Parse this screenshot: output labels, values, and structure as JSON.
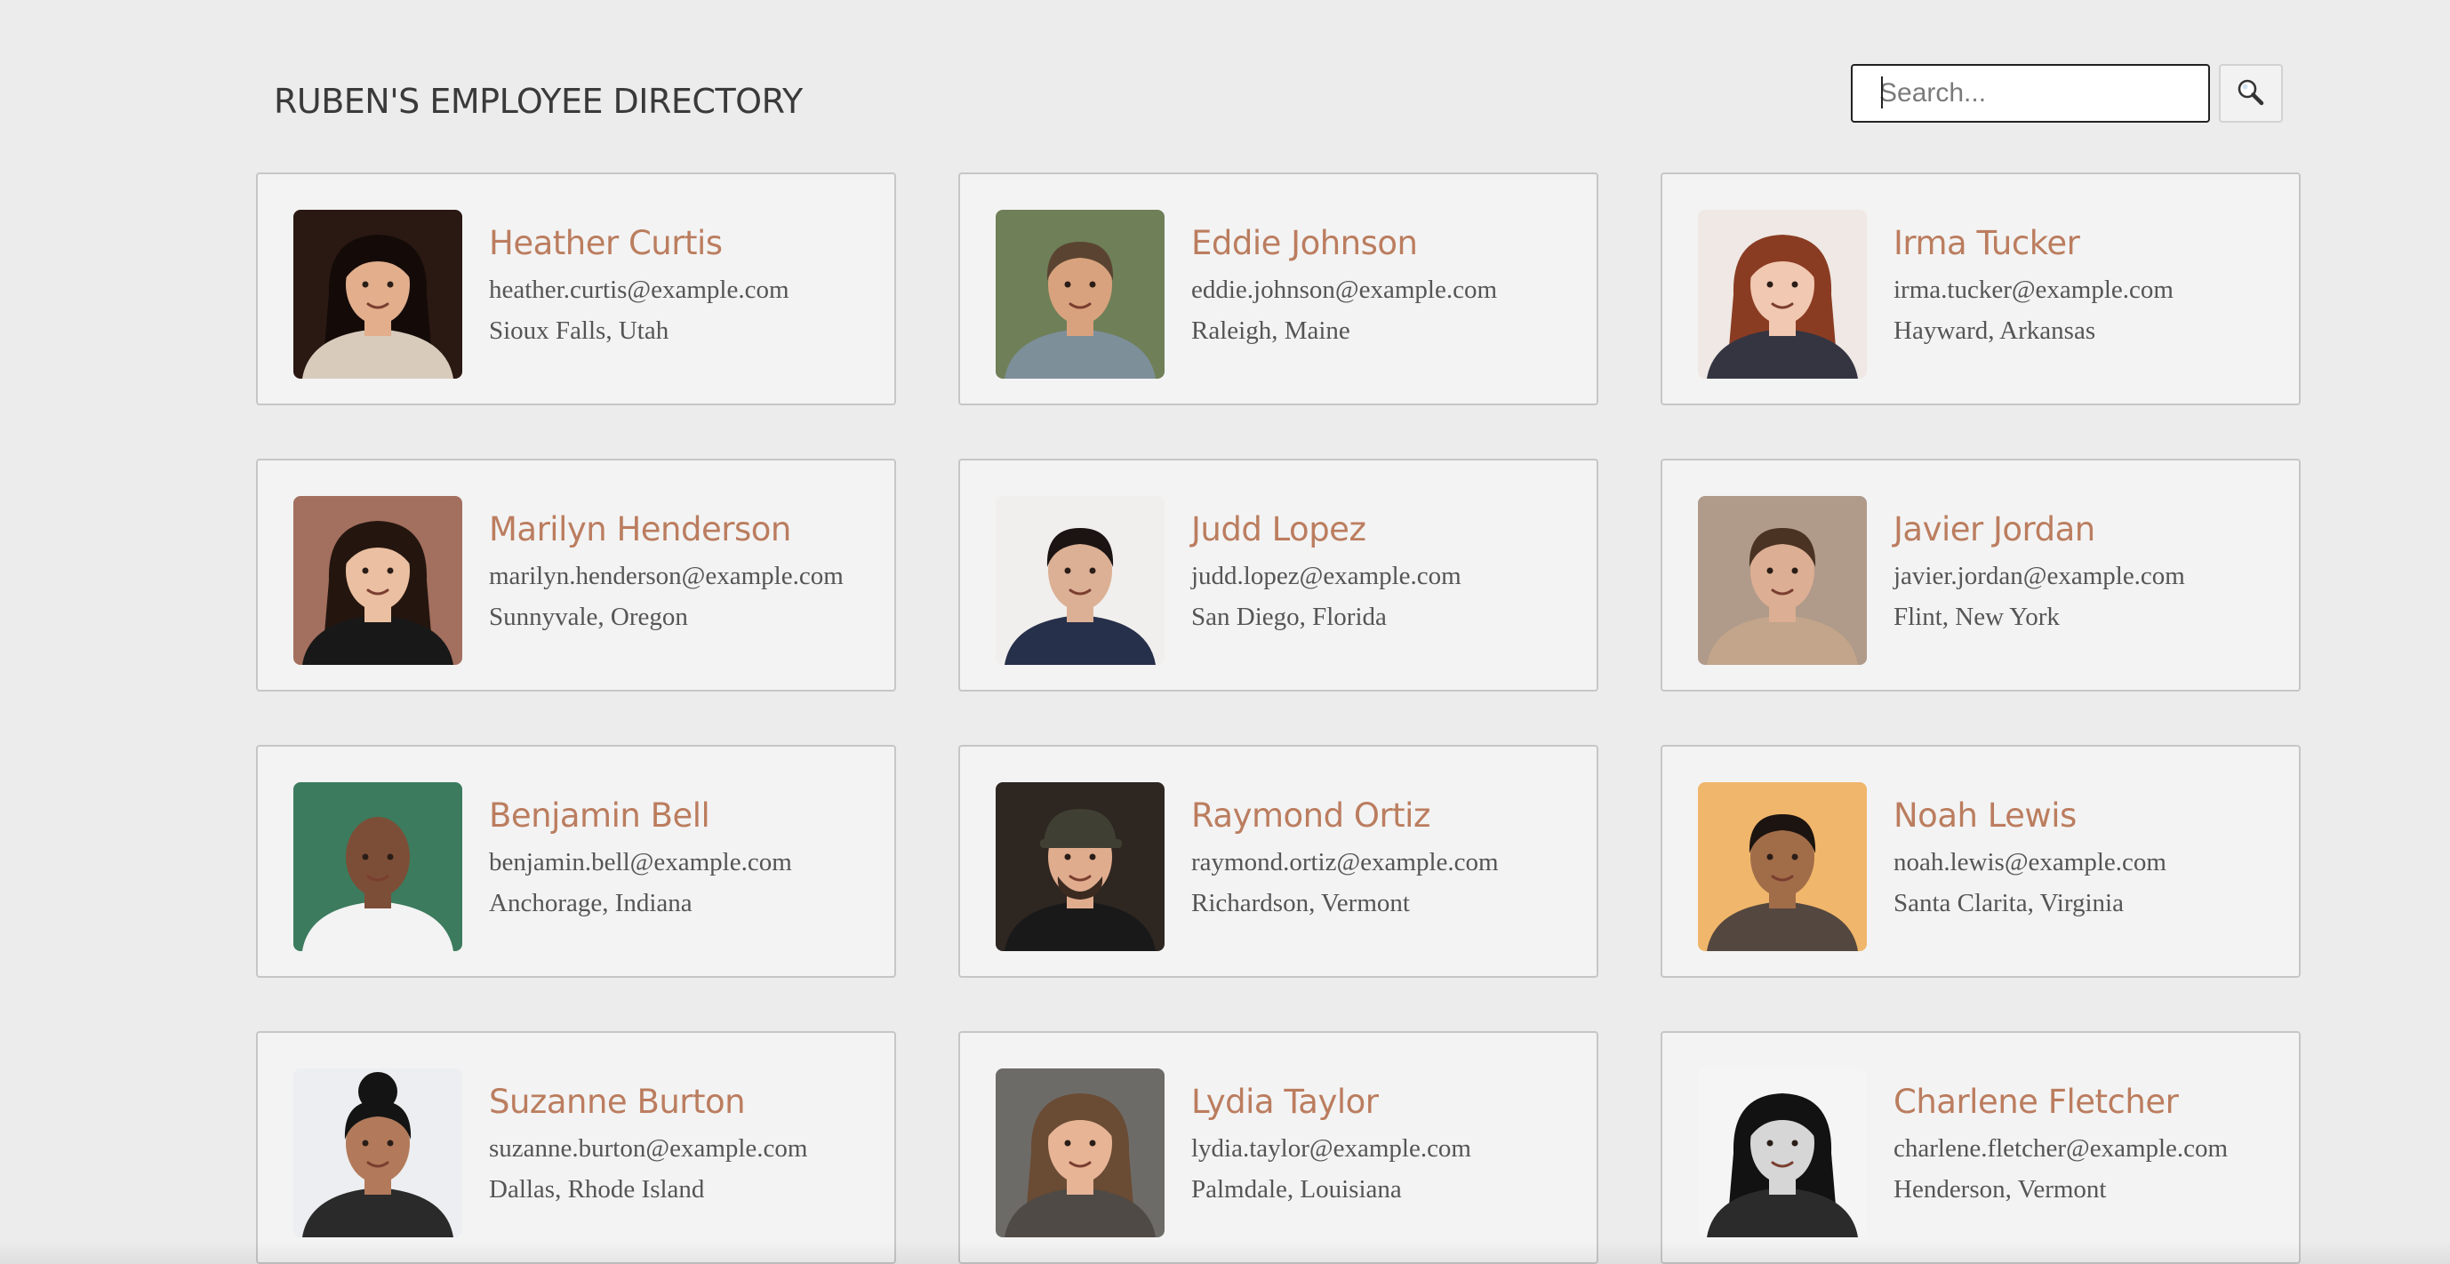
{
  "header": {
    "title": "RUBEN'S EMPLOYEE DIRECTORY"
  },
  "search": {
    "placeholder": "Search...",
    "value": "",
    "button_icon": "search-icon"
  },
  "employees": [
    {
      "name": "Heather Curtis",
      "email": "heather.curtis@example.com",
      "location": "Sioux Falls, Utah",
      "avatar": {
        "bg": "#2a1812",
        "skin": "#e2ae8c",
        "hair": "#140b08",
        "shirt": "#d8cbbc",
        "hair_style": "long"
      }
    },
    {
      "name": "Eddie Johnson",
      "email": "eddie.johnson@example.com",
      "location": "Raleigh, Maine",
      "avatar": {
        "bg": "#6f7f58",
        "skin": "#d9a27e",
        "hair": "#5a4431",
        "shirt": "#7d8f99",
        "hair_style": "short"
      }
    },
    {
      "name": "Irma Tucker",
      "email": "irma.tucker@example.com",
      "location": "Hayward, Arkansas",
      "avatar": {
        "bg": "#efe8e4",
        "skin": "#f1c8b1",
        "hair": "#8a3c22",
        "shirt": "#353542",
        "hair_style": "long"
      }
    },
    {
      "name": "Marilyn Henderson",
      "email": "marilyn.henderson@example.com",
      "location": "Sunnyvale, Oregon",
      "avatar": {
        "bg": "#a36f5e",
        "skin": "#ebbfa1",
        "hair": "#24160f",
        "shirt": "#181818",
        "hair_style": "long"
      }
    },
    {
      "name": "Judd Lopez",
      "email": "judd.lopez@example.com",
      "location": "San Diego, Florida",
      "avatar": {
        "bg": "#f1efee",
        "skin": "#dcb095",
        "hair": "#1b1413",
        "shirt": "#26304a",
        "hair_style": "short"
      }
    },
    {
      "name": "Javier Jordan",
      "email": "javier.jordan@example.com",
      "location": "Flint, New York",
      "avatar": {
        "bg": "#b09a8a",
        "skin": "#dcae93",
        "hair": "#4a3323",
        "shirt": "#c2a58a",
        "hair_style": "short"
      }
    },
    {
      "name": "Benjamin Bell",
      "email": "benjamin.bell@example.com",
      "location": "Anchorage, Indiana",
      "avatar": {
        "bg": "#3c7b5e",
        "skin": "#7d4e37",
        "hair": "#7d4e37",
        "shirt": "#f3f3f3",
        "hair_style": "bald"
      }
    },
    {
      "name": "Raymond Ortiz",
      "email": "raymond.ortiz@example.com",
      "location": "Richardson, Vermont",
      "avatar": {
        "bg": "#2e2621",
        "skin": "#e0ac8e",
        "hair": "#3f3f33",
        "shirt": "#191919",
        "hair_style": "cap"
      }
    },
    {
      "name": "Noah Lewis",
      "email": "noah.lewis@example.com",
      "location": "Santa Clarita, Virginia",
      "avatar": {
        "bg": "#f0b66b",
        "skin": "#a16c48",
        "hair": "#1c1410",
        "shirt": "#54473f",
        "hair_style": "short"
      }
    },
    {
      "name": "Suzanne Burton",
      "email": "suzanne.burton@example.com",
      "location": "Dallas, Rhode Island",
      "avatar": {
        "bg": "#eceef1",
        "skin": "#b27a5a",
        "hair": "#141414",
        "shirt": "#2a2a2a",
        "hair_style": "bun"
      }
    },
    {
      "name": "Lydia Taylor",
      "email": "lydia.taylor@example.com",
      "location": "Palmdale, Louisiana",
      "avatar": {
        "bg": "#6d6b67",
        "skin": "#e7b496",
        "hair": "#6a4b34",
        "shirt": "#4f4a45",
        "hair_style": "long"
      }
    },
    {
      "name": "Charlene Fletcher",
      "email": "charlene.fletcher@example.com",
      "location": "Henderson, Vermont",
      "avatar": {
        "bg": "#f5f5f5",
        "skin": "#d6d6d6",
        "hair": "#121212",
        "shirt": "#2b2b2b",
        "hair_style": "long"
      }
    }
  ]
}
